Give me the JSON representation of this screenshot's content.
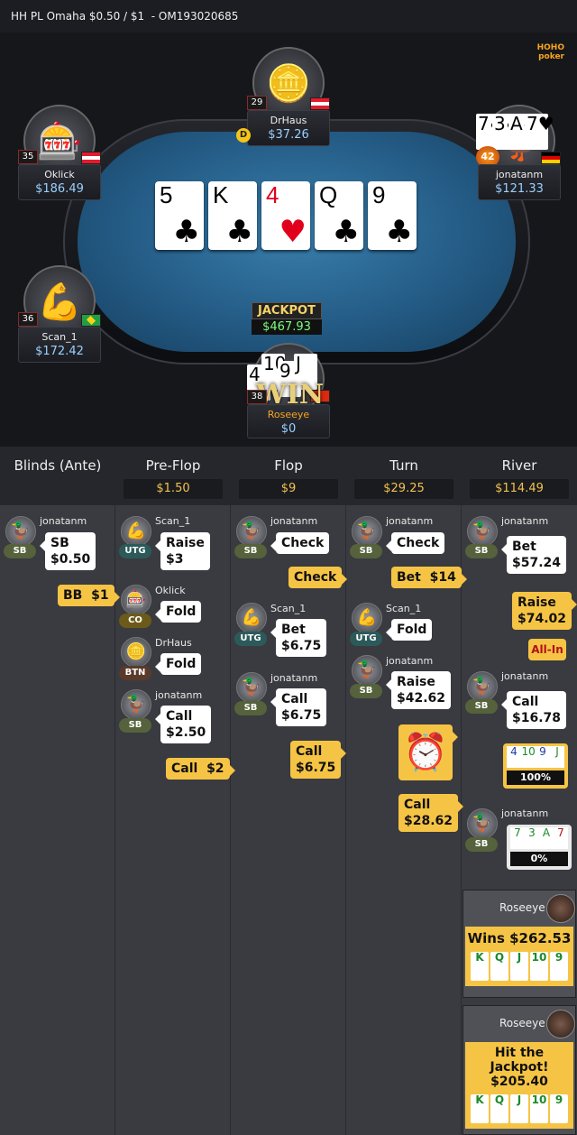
{
  "header": {
    "title": "HH PL Omaha $0.50 / $1",
    "hand_id": "  - OM193020685"
  },
  "brand": {
    "logo": "HOHO poker"
  },
  "table": {
    "seats": [
      {
        "name": "DrHaus",
        "stack": "$37.26",
        "level": "29",
        "dealer_chip": "D"
      },
      {
        "name": "Oklick",
        "stack": "$186.49",
        "level": "35"
      },
      {
        "name": "jonatanm",
        "stack": "$121.33",
        "level": "42",
        "cards": [
          "7♣",
          "3♣",
          "A♣",
          "7♥"
        ]
      },
      {
        "name": "Scan_1",
        "stack": "$172.42",
        "level": "36"
      },
      {
        "name": "Roseeye",
        "stack": "$0",
        "level": "38",
        "cards": [
          "4",
          "10",
          "9",
          "J"
        ],
        "win_text": "WIN"
      }
    ],
    "board": [
      {
        "rank": "5",
        "suit": "♣"
      },
      {
        "rank": "K",
        "suit": "♣"
      },
      {
        "rank": "4",
        "suit": "♥"
      },
      {
        "rank": "Q",
        "suit": "♣"
      },
      {
        "rank": "9",
        "suit": "♣"
      }
    ],
    "jackpot_label": "JACKPOT",
    "jackpot_value": "$467.93"
  },
  "history": {
    "columns": [
      {
        "title": "Blinds (Ante)",
        "pot": ""
      },
      {
        "title": "Pre-Flop",
        "pot": "$1.50"
      },
      {
        "title": "Flop",
        "pot": "$9"
      },
      {
        "title": "Turn",
        "pot": "$29.25"
      },
      {
        "title": "River",
        "pot": "$114.49"
      }
    ],
    "blinds": {
      "sb_name": "jonatanm",
      "sb_pos": "SB",
      "sb_line1": "SB",
      "sb_line2": "$0.50",
      "bb": "BB  $1"
    },
    "preflop": [
      {
        "name": "Scan_1",
        "pos": "UTG",
        "l1": "Raise",
        "l2": "$3"
      },
      {
        "name": "Oklick",
        "pos": "CO",
        "l1": "Fold",
        "l2": ""
      },
      {
        "name": "DrHaus",
        "pos": "BTN",
        "l1": "Fold",
        "l2": ""
      },
      {
        "name": "jonatanm",
        "pos": "SB",
        "l1": "Call",
        "l2": "$2.50"
      }
    ],
    "preflop_y": "Call  $2",
    "flop": [
      {
        "name": "jonatanm",
        "pos": "SB",
        "l1": "Check",
        "l2": ""
      },
      {
        "name": "Scan_1",
        "pos": "UTG",
        "l1": "Bet",
        "l2": "$6.75"
      },
      {
        "name": "jonatanm",
        "pos": "SB",
        "l1": "Call",
        "l2": "$6.75"
      }
    ],
    "flop_y1": "Check",
    "flop_y2_l1": "Call",
    "flop_y2_l2": "$6.75",
    "turn": [
      {
        "name": "jonatanm",
        "pos": "SB",
        "l1": "Check",
        "l2": ""
      },
      {
        "name": "Scan_1",
        "pos": "UTG",
        "l1": "Fold",
        "l2": ""
      },
      {
        "name": "jonatanm",
        "pos": "SB",
        "l1": "Raise",
        "l2": "$42.62"
      }
    ],
    "turn_y1": "Bet  $14",
    "turn_y2_l1": "Call",
    "turn_y2_l2": "$28.62",
    "river": [
      {
        "name": "jonatanm",
        "pos": "SB",
        "l1": "Bet",
        "l2": "$57.24"
      },
      {
        "name": "jonatanm",
        "pos": "SB",
        "l1": "Call",
        "l2": "$16.78"
      },
      {
        "name": "jonatanm",
        "pos": "SB"
      }
    ],
    "river_y1_l1": "Raise",
    "river_y1_l2": "$74.02",
    "all_in": "All-In",
    "hand_roseeye": {
      "cards": [
        "4",
        "10",
        "9",
        "J"
      ],
      "pct": "100%"
    },
    "hand_jonatanm": {
      "cards": [
        "7",
        "3",
        "A",
        "7"
      ],
      "pct": "0%"
    },
    "win1": {
      "name": "Roseeye",
      "text": "Wins $262.53",
      "cards": [
        "K",
        "Q",
        "J",
        "10",
        "9"
      ]
    },
    "win2": {
      "name": "Roseeye",
      "text1": "Hit the Jackpot!",
      "text2": "$205.40",
      "cards": [
        "K",
        "Q",
        "J",
        "10",
        "9"
      ]
    }
  },
  "colors": {
    "accent": "#f6c445",
    "stack": "#9ad0ff",
    "felt": "#245c86"
  }
}
